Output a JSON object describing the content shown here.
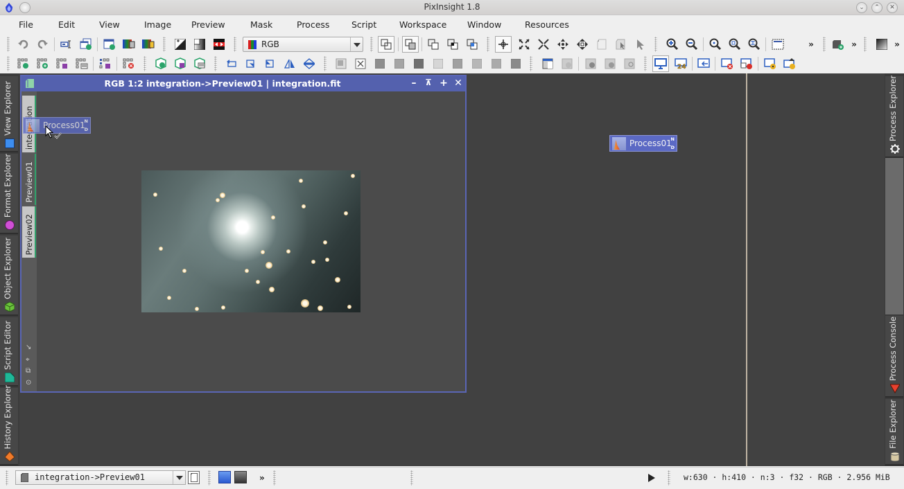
{
  "window": {
    "title": "PixInsight 1.8",
    "controls": [
      "minimize",
      "maximize",
      "close"
    ]
  },
  "menu": {
    "items": [
      "File",
      "Edit",
      "View",
      "Image",
      "Preview",
      "Mask",
      "Process",
      "Script",
      "Workspace",
      "Window",
      "Resources"
    ]
  },
  "toolbar": {
    "color_space_combo": {
      "value": "RGB"
    },
    "overflow_label": "»"
  },
  "left_panels": [
    {
      "label": "View Explorer",
      "icon": "square-blue-icon",
      "color": "#3d8ef0"
    },
    {
      "label": "Format Explorer",
      "icon": "circle-magenta-icon",
      "color": "#d04fd6"
    },
    {
      "label": "Object Explorer",
      "icon": "cube-green-icon",
      "color": "#6ac33b"
    },
    {
      "label": "Script Editor",
      "icon": "document-teal-icon",
      "color": "#1fb898"
    },
    {
      "label": "History Explorer",
      "icon": "diamond-orange-icon",
      "color": "#f07b2a"
    }
  ],
  "right_panels": [
    {
      "label": "Process Explorer",
      "icon": "gear-icon"
    },
    {
      "label": "Process Console",
      "icon": "triangle-red-icon",
      "color": "#e8412e"
    },
    {
      "label": "File Explorer",
      "icon": "cylinder-icon",
      "color": "#d6c8a2"
    }
  ],
  "image_window": {
    "title": "RGB 1:2 integration->Preview01 | integration.fit",
    "view_tabs": [
      "integration",
      "Preview01",
      "Preview02"
    ],
    "active_tab": "Preview01"
  },
  "process_icons": [
    {
      "label": "Process01",
      "badge_top": "N",
      "badge_bottom": "D",
      "state": "dragging"
    },
    {
      "label": "Process01",
      "badge_top": "N",
      "badge_bottom": "D",
      "state": "placed"
    }
  ],
  "statusbar": {
    "current_view": "integration->Preview01",
    "overflow_label": "»",
    "info": "w:630 · h:410 · n:3 · f32 · RGB · 2.956 MiB"
  }
}
